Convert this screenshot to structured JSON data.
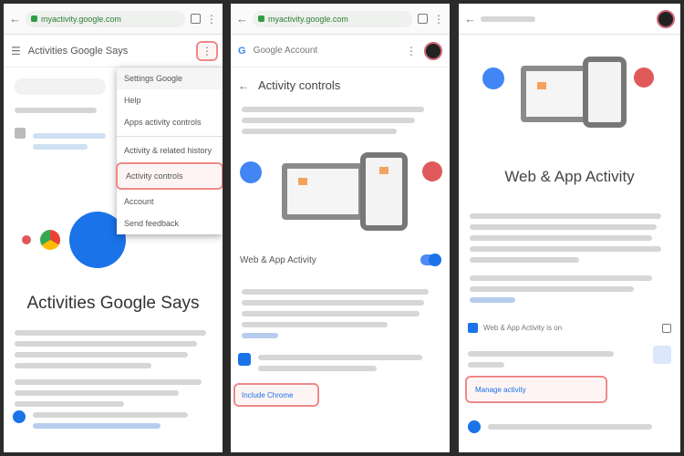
{
  "panel1": {
    "url": "myactivity.google.com",
    "title": "Activities Google Says",
    "menu_items": [
      "Settings Google",
      "Help",
      "Apps activity controls",
      "Activity & related history",
      "Activity controls",
      "Account",
      "Send feedback"
    ],
    "heading": "Activities Google Says"
  },
  "panel2": {
    "url": "myactivity.google.com",
    "app_name": "Google Account",
    "title": "Activity controls",
    "toggle_label": "Web & App Activity",
    "action": "Include Chrome"
  },
  "panel3": {
    "title": "Web & App Activity",
    "checkbox_label": "Web & App Activity is on",
    "action": "Manage activity"
  },
  "colors": {
    "accent": "#1a73e8",
    "highlight": "#e88888",
    "green": "#2e9e41",
    "red": "#e0595a"
  }
}
